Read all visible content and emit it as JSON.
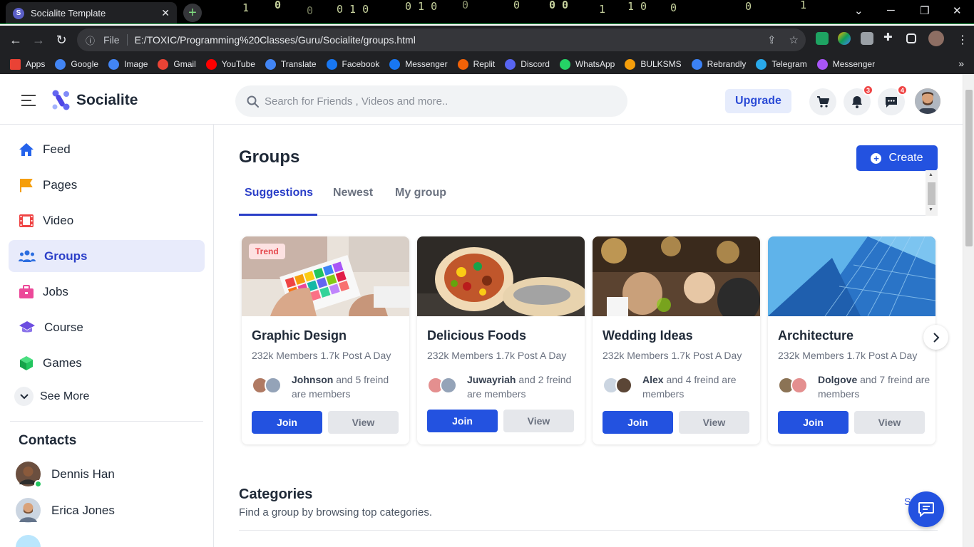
{
  "browser": {
    "tab_title": "Socialite Template",
    "tab_favicon": "S",
    "file_label": "File",
    "url": "E:/TOXIC/Programming%20Classes/Guru/Socialite/groups.html",
    "bookmarks": [
      {
        "label": "Apps",
        "icon": "apps-grid-icon",
        "color": "#e94235"
      },
      {
        "label": "Google",
        "icon": "google-icon",
        "color": "#4285f4"
      },
      {
        "label": "Image",
        "icon": "google-icon",
        "color": "#4285f4"
      },
      {
        "label": "Gmail",
        "icon": "gmail-icon",
        "color": "#ea4335"
      },
      {
        "label": "YouTube",
        "icon": "youtube-icon",
        "color": "#ff0000"
      },
      {
        "label": "Translate",
        "icon": "translate-icon",
        "color": "#4285f4"
      },
      {
        "label": "Facebook",
        "icon": "facebook-icon",
        "color": "#1877f2"
      },
      {
        "label": "Messenger",
        "icon": "facebook-icon",
        "color": "#1877f2"
      },
      {
        "label": "Replit",
        "icon": "replit-icon",
        "color": "#f26207"
      },
      {
        "label": "Discord",
        "icon": "discord-icon",
        "color": "#5865f2"
      },
      {
        "label": "WhatsApp",
        "icon": "whatsapp-icon",
        "color": "#25d366"
      },
      {
        "label": "BULKSMS",
        "icon": "bulksms-icon",
        "color": "#f59e0b"
      },
      {
        "label": "Rebrandly",
        "icon": "rebrandly-icon",
        "color": "#3b82f6"
      },
      {
        "label": "Telegram",
        "icon": "telegram-icon",
        "color": "#29a9eb"
      },
      {
        "label": "Messenger",
        "icon": "messenger-icon",
        "color": "#a855f7"
      }
    ]
  },
  "header": {
    "logo_text": "Socialite",
    "search_placeholder": "Search for Friends , Videos and more..",
    "upgrade_label": "Upgrade",
    "notifications_count": "3",
    "messages_count": "4"
  },
  "sidebar": {
    "items": [
      {
        "label": "Feed",
        "icon": "home-icon",
        "color": "#2563eb"
      },
      {
        "label": "Pages",
        "icon": "flag-icon",
        "color": "#f59e0b"
      },
      {
        "label": "Video",
        "icon": "film-icon",
        "color": "#ef4444"
      },
      {
        "label": "Groups",
        "icon": "users-icon",
        "color": "#2b6de0"
      },
      {
        "label": "Jobs",
        "icon": "briefcase-icon",
        "color": "#ec4899"
      },
      {
        "label": "Course",
        "icon": "graduation-cap-icon",
        "color": "#6d4de0"
      },
      {
        "label": "Games",
        "icon": "cube-icon",
        "color": "#22c55e"
      }
    ],
    "see_more": "See More",
    "contacts_title": "Contacts",
    "contacts": [
      {
        "name": "Dennis Han"
      },
      {
        "name": "Erica Jones"
      }
    ]
  },
  "main": {
    "title": "Groups",
    "create_label": "Create",
    "tabs": [
      "Suggestions",
      "Newest",
      "My group"
    ],
    "groups": [
      {
        "name": "Graphic Design",
        "stats": "232k Members 1.7k Post A Day",
        "member_name": "Johnson",
        "member_text": " and 5 freind are members",
        "badge": "Trend",
        "join": "Join",
        "view": "View"
      },
      {
        "name": "Delicious Foods",
        "stats": "232k Members 1.7k Post A Day",
        "member_name": "Juwayriah",
        "member_text": " and 2 freind are members",
        "join": "Join",
        "view": "View"
      },
      {
        "name": "Wedding Ideas",
        "stats": "232k Members 1.7k Post A Day",
        "member_name": "Alex",
        "member_text": " and 4 freind are members",
        "join": "Join",
        "view": "View"
      },
      {
        "name": "Architecture",
        "stats": "232k Members 1.7k Post A Day",
        "member_name": "Dolgove",
        "member_text": " and 7 freind are members",
        "join": "Join",
        "view": "View"
      }
    ],
    "categories_title": "Categories",
    "categories_subtitle": "Find a group by browsing top categories.",
    "see_all": "S"
  }
}
